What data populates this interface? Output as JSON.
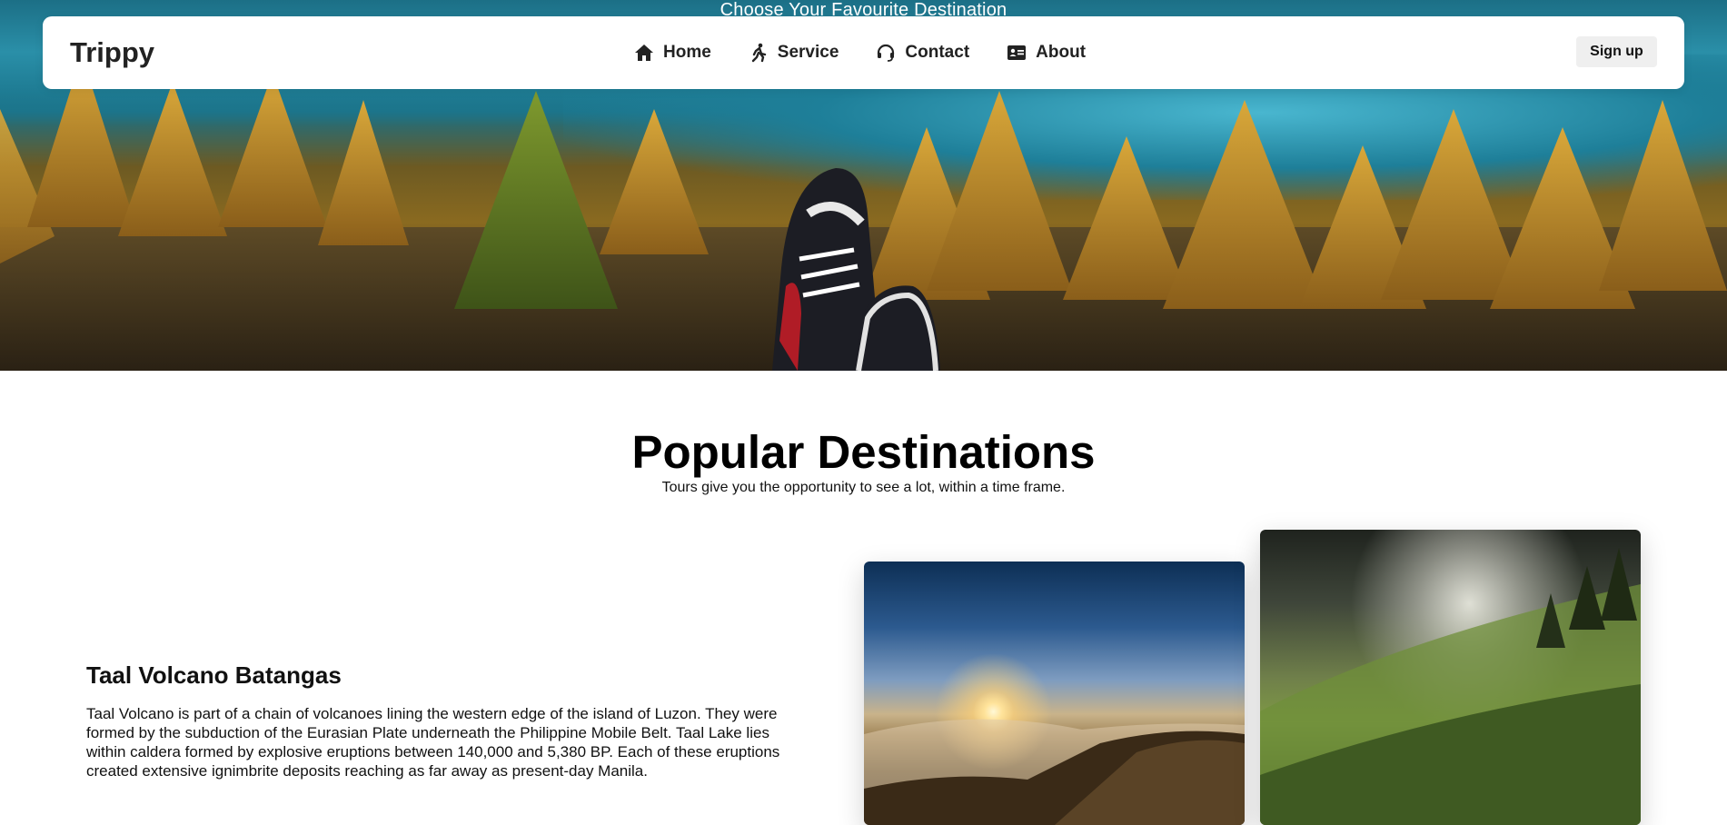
{
  "hero": {
    "title": "Choose Your Favourite Destination"
  },
  "navbar": {
    "brand": "Trippy",
    "links": [
      {
        "label": "Home",
        "icon": "home-icon"
      },
      {
        "label": "Service",
        "icon": "person-walking-icon"
      },
      {
        "label": "Contact",
        "icon": "headset-icon"
      },
      {
        "label": "About",
        "icon": "id-card-icon"
      }
    ],
    "signup_label": "Sign up"
  },
  "section": {
    "title": "Popular Destinations",
    "subtitle": "Tours give you the opportunity to see a lot, within a time frame."
  },
  "destination": {
    "title": "Taal Volcano Batangas",
    "text": "Taal Volcano is part of a chain of volcanoes lining the western edge of the island of Luzon. They were formed by the subduction of the Eurasian Plate underneath the Philippine Mobile Belt. Taal Lake lies within caldera formed by explosive eruptions between 140,000 and 5,380 BP. Each of these eruptions created extensive ignimbrite deposits reaching as far away as present-day Manila."
  },
  "colors": {
    "navbar_bg": "#ffffff",
    "signup_bg": "#efefef",
    "text": "#111111"
  }
}
